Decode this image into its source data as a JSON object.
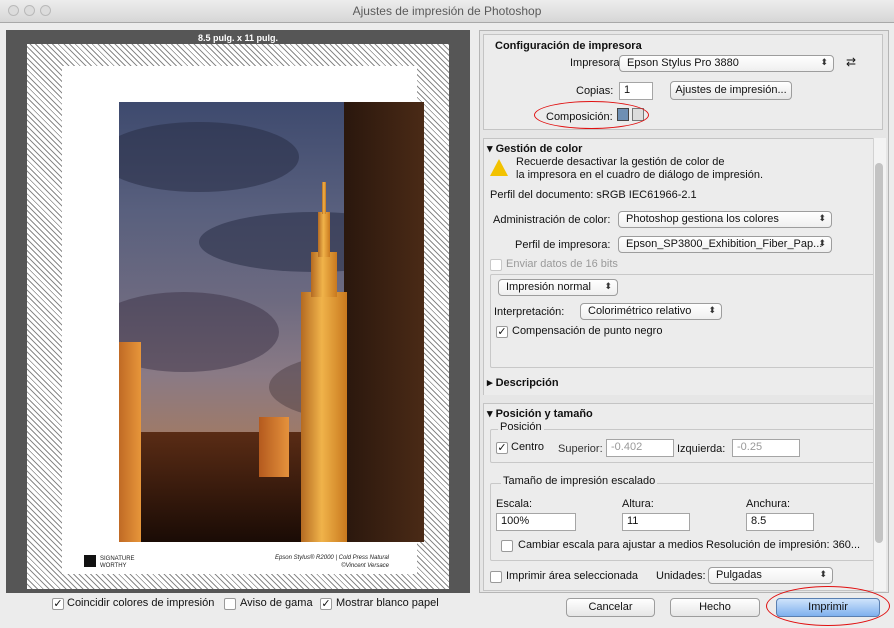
{
  "window": {
    "title": "Ajustes de impresión de Photoshop"
  },
  "preview": {
    "paper_size": "8.5 pulg. x 11 pulg.",
    "logo_text": "SIGNATURE\nWORTHY",
    "caption_line1": "Epson Stylus® R2000 | Cold Press Natural",
    "caption_line2": "©Vincent Versace"
  },
  "printer_setup": {
    "heading": "Configuración de impresora",
    "printer_label": "Impresora:",
    "printer_value": "Epson Stylus Pro 3880",
    "copies_label": "Copias:",
    "copies_value": "1",
    "print_settings_button": "Ajustes de impresión...",
    "layout_label": "Composición:"
  },
  "color_management": {
    "heading": "Gestión de color",
    "warning_line1": "Recuerde desactivar la gestión de color de",
    "warning_line2": "la impresora en el cuadro de diálogo de impresión.",
    "document_profile": "Perfil del documento: sRGB IEC61966-2.1",
    "color_handling_label": "Administración de color:",
    "color_handling_value": "Photoshop gestiona los colores",
    "printer_profile_label": "Perfil de impresora:",
    "printer_profile_value": "Epson_SP3800_Exhibition_Fiber_Pap...",
    "send_16bit": "Enviar datos de 16 bits",
    "print_mode_value": "Impresión normal",
    "rendering_label": "Interpretación:",
    "rendering_value": "Colorimétrico relativo",
    "black_point": "Compensación de punto negro"
  },
  "description": {
    "heading": "Descripción"
  },
  "position_size": {
    "heading": "Posición y tamaño",
    "position_group": "Posición",
    "center_label": "Centro",
    "top_label": "Superior:",
    "top_value": "-0.402",
    "left_label": "Izquierda:",
    "left_value": "-0.25",
    "scaled_group": "Tamaño de impresión escalado",
    "scale_label": "Escala:",
    "scale_value": "100%",
    "height_label": "Altura:",
    "height_value": "11",
    "width_label": "Anchura:",
    "width_value": "8.5",
    "scale_to_fit": "Cambiar escala para ajustar a medios",
    "resolution": "Resolución de impresión: 360...",
    "print_selected": "Imprimir área seleccionada",
    "units_label": "Unidades:",
    "units_value": "Pulgadas"
  },
  "bottom": {
    "match_colors": "Coincidir colores de impresión",
    "gamut_warning": "Aviso de gama",
    "show_paper_white": "Mostrar blanco papel",
    "cancel": "Cancelar",
    "done": "Hecho",
    "print": "Imprimir"
  },
  "colors": {
    "highlight": "#e01010",
    "warning": "#f2c200"
  }
}
